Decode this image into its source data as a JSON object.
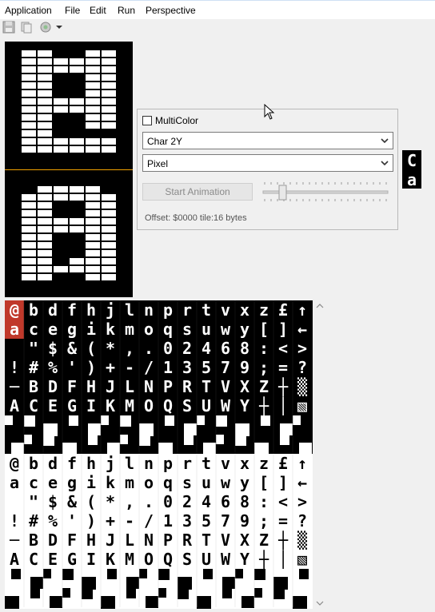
{
  "menu": {
    "items": [
      "Application",
      "File",
      "Edit",
      "Run",
      "Perspective"
    ]
  },
  "toolbar": {
    "icons": [
      "save-icon",
      "copy-icon",
      "run-config-icon",
      "dropdown-arrow-icon"
    ]
  },
  "panel": {
    "multicolor_label": "MultiColor",
    "multicolor_checked": false,
    "char_select_value": "Char 2Y",
    "mode_select_value": "Pixel",
    "animation_button_label": "Start Animation",
    "offset_text": "Offset: $0000 tile:16 bytes"
  },
  "preview": {
    "glyphs": [
      "C",
      "a"
    ]
  },
  "charset": {
    "rows": [
      "@bdfhjlnprtvxz£↑",
      "acegikmoqsuwy[]←",
      " \"$&(*,.02468:<>",
      "!#%')+-/13579;=?",
      "─BDFHJLNPRTVXZ┼▒",
      "ACEGIKMOQSUWY┼│▧"
    ],
    "selected_index": 0
  },
  "colors": {
    "menubar_bg": "#ffffff",
    "window_bg": "#f0f0f0",
    "pixel_on": "#ffffff",
    "pixel_off": "#000000",
    "selection": "#c0392b",
    "divider": "#f0a000"
  }
}
